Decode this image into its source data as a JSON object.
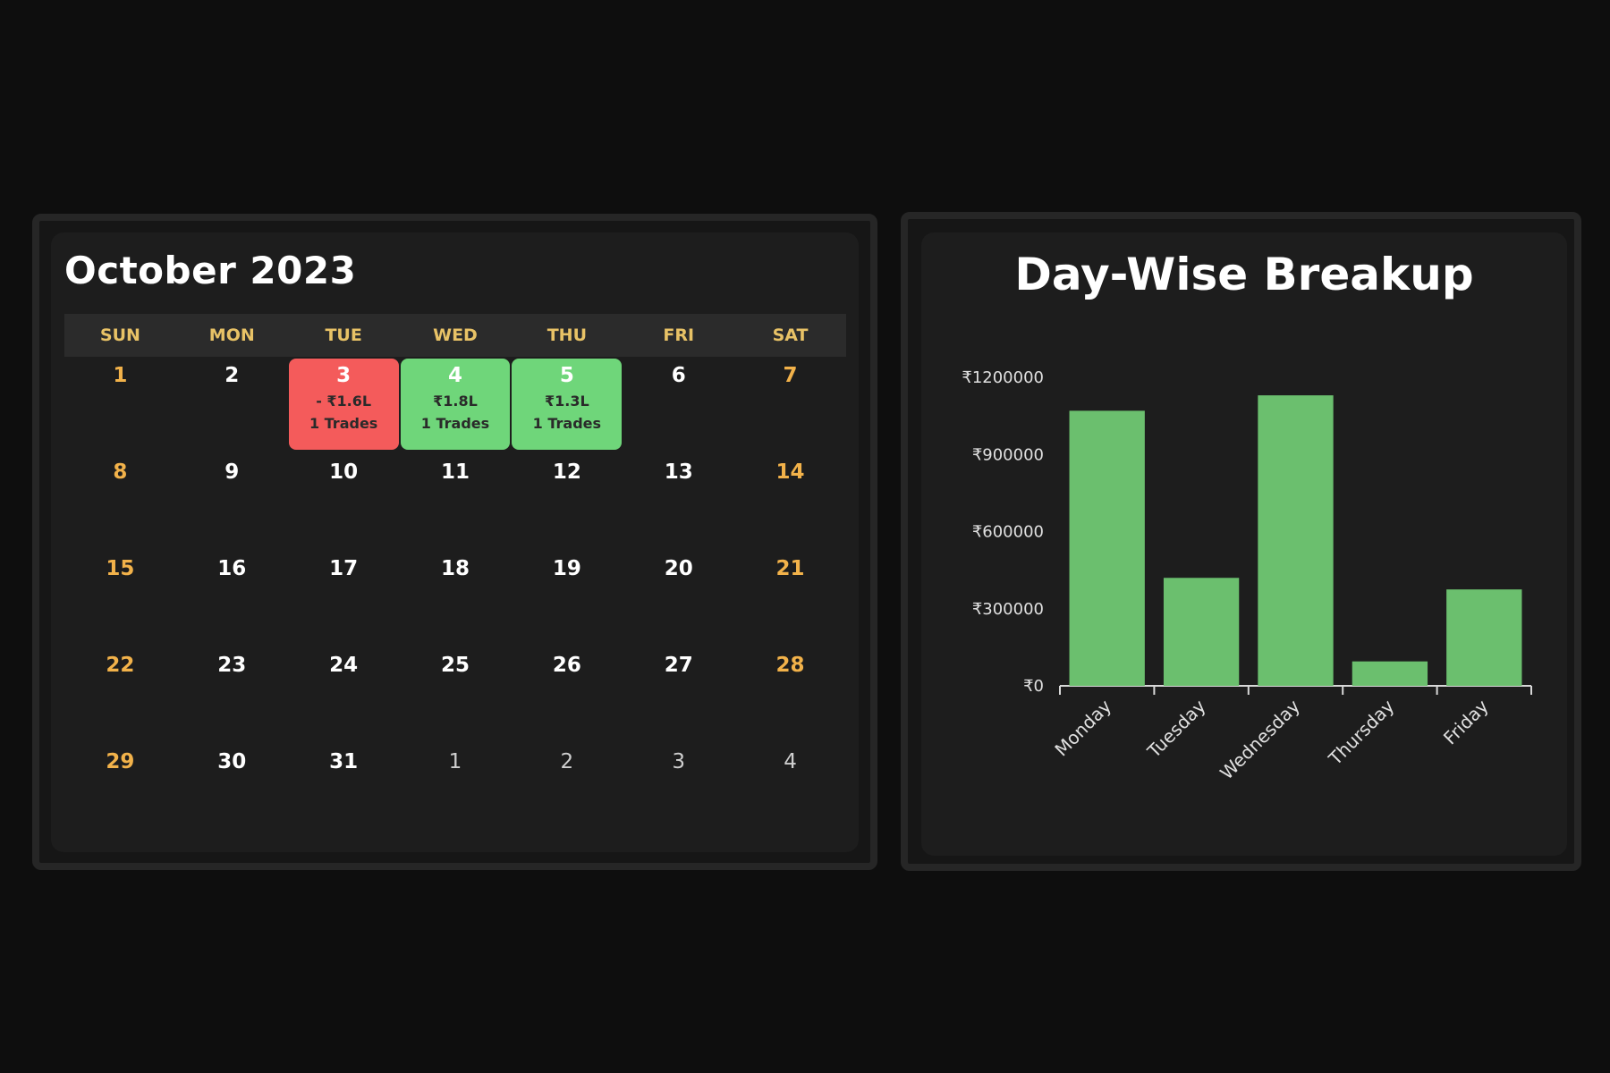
{
  "calendar": {
    "title": "October 2023",
    "weekdays": [
      "SUN",
      "MON",
      "TUE",
      "WED",
      "THU",
      "FRI",
      "SAT"
    ],
    "days": [
      {
        "n": "1",
        "kind": "weekend"
      },
      {
        "n": "2",
        "kind": "normal"
      },
      {
        "n": "3",
        "kind": "loss",
        "amount": "- ₹1.6L",
        "trades": "1 Trades"
      },
      {
        "n": "4",
        "kind": "profit",
        "amount": "₹1.8L",
        "trades": "1 Trades"
      },
      {
        "n": "5",
        "kind": "profit",
        "amount": "₹1.3L",
        "trades": "1 Trades"
      },
      {
        "n": "6",
        "kind": "normal"
      },
      {
        "n": "7",
        "kind": "weekend"
      },
      {
        "n": "8",
        "kind": "weekend"
      },
      {
        "n": "9",
        "kind": "normal"
      },
      {
        "n": "10",
        "kind": "normal"
      },
      {
        "n": "11",
        "kind": "normal"
      },
      {
        "n": "12",
        "kind": "normal"
      },
      {
        "n": "13",
        "kind": "normal"
      },
      {
        "n": "14",
        "kind": "weekend"
      },
      {
        "n": "15",
        "kind": "weekend"
      },
      {
        "n": "16",
        "kind": "normal"
      },
      {
        "n": "17",
        "kind": "normal"
      },
      {
        "n": "18",
        "kind": "normal"
      },
      {
        "n": "19",
        "kind": "normal"
      },
      {
        "n": "20",
        "kind": "normal"
      },
      {
        "n": "21",
        "kind": "weekend"
      },
      {
        "n": "22",
        "kind": "weekend"
      },
      {
        "n": "23",
        "kind": "normal"
      },
      {
        "n": "24",
        "kind": "normal"
      },
      {
        "n": "25",
        "kind": "normal"
      },
      {
        "n": "26",
        "kind": "normal"
      },
      {
        "n": "27",
        "kind": "normal"
      },
      {
        "n": "28",
        "kind": "weekend"
      },
      {
        "n": "29",
        "kind": "weekend"
      },
      {
        "n": "30",
        "kind": "normal"
      },
      {
        "n": "31",
        "kind": "normal"
      },
      {
        "n": "1",
        "kind": "other"
      },
      {
        "n": "2",
        "kind": "other"
      },
      {
        "n": "3",
        "kind": "other"
      },
      {
        "n": "4",
        "kind": "other"
      }
    ]
  },
  "colors": {
    "loss": "#f45b5b",
    "profit": "#6fd67a",
    "bar": "#6bbf6e",
    "weekend": "#f2b24a",
    "weekday_header": "#e8c266"
  },
  "chart_data": {
    "type": "bar",
    "title": "Day-Wise Breakup",
    "categories": [
      "Monday",
      "Tuesday",
      "Wednesday",
      "Thursday",
      "Friday"
    ],
    "values": [
      1070000,
      420000,
      1130000,
      95000,
      375000
    ],
    "yticks": [
      "₹0",
      "₹300000",
      "₹600000",
      "₹900000",
      "₹1200000"
    ],
    "ylim": [
      0,
      1200000
    ],
    "xlabel": "",
    "ylabel": "",
    "grid": false,
    "legend": "none"
  }
}
